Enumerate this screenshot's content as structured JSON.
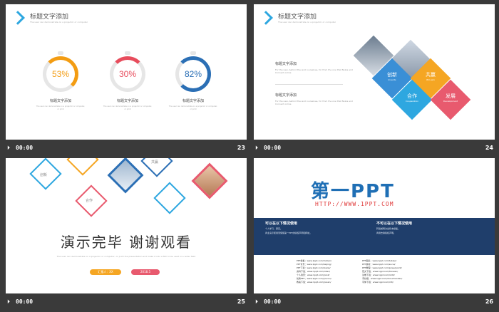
{
  "slides": [
    {
      "number": "23",
      "time": "00:00",
      "title": "标题文字添加",
      "subtitle": "The user can demonstrate on a projector or computer",
      "rings": [
        {
          "value": "53%",
          "color": "#f39c12",
          "caption": "标题文字添加",
          "desc": "The user can demonstrate on a projector or computer, or print"
        },
        {
          "value": "30%",
          "color": "#e74c5c",
          "caption": "标题文字添加",
          "desc": "The user can demonstrate on a projector or computer, or print"
        },
        {
          "value": "82%",
          "color": "#2b6fb5",
          "caption": "标题文字添加",
          "desc": "The user can demonstrate on a projector or computer, or print"
        }
      ]
    },
    {
      "number": "24",
      "time": "00:00",
      "title": "标题文字添加",
      "subtitle": "The user can demonstrate on a projector or computer",
      "blocks": [
        {
          "heading": "标题文字添加",
          "text": "For the new, behind the work ourselves, for from the one that Nokia and Connect online"
        },
        {
          "heading": "标题文字添加",
          "text": "For the new, behind the work ourselves, for from the one that Nokia and Connect online"
        }
      ],
      "diamonds": [
        {
          "label": "创新",
          "sub": "Invents",
          "color": "#3a8fd6"
        },
        {
          "label": "共赢",
          "sub": "Win-win",
          "color": "#f5a623"
        },
        {
          "label": "合作",
          "sub": "Cooperation",
          "color": "#2ea7e0"
        },
        {
          "label": "发展",
          "sub": "Development",
          "color": "#e85a6e"
        }
      ]
    },
    {
      "number": "25",
      "time": "00:00",
      "main_text": "演示完毕  谢谢观看",
      "sub_text": "The user can demonstrate on a projector or computer, or print the presentation and make it into a film to be used in a wider field",
      "small_labels": [
        "创新",
        "共赢",
        "合作"
      ],
      "buttons": [
        "汇报人：XX",
        "2018.5"
      ]
    },
    {
      "number": "26",
      "time": "00:00",
      "logo": "第一PPT",
      "url": "HTTP://WWW.1PPT.COM",
      "can_title": "可以在以下情况使用",
      "can_items": [
        "个人学习、研究。",
        "商业演示使用须保留第一PPT的版权声明和网址。"
      ],
      "cannot_title": "不可以在以下情况使用",
      "cannot_items": [
        "转载或再次出售本模板。",
        "商用去除版权声明。"
      ],
      "links_left": [
        "PPT模板：www.1ppt.com/moban/",
        "PPT背景：www.1ppt.com/beijing/",
        "PPT下载：www.1ppt.com/xiazai/",
        "资料下载：www.1ppt.com/ziliao/",
        "个人简历：www.1ppt.com/jianli/",
        "优秀PPT：www.1ppt.com/youxiu/",
        "教案下载：www.1ppt.com/jiaoan/"
      ],
      "links_right": [
        "PPT图表：www.1ppt.com/tubiao/",
        "PPT素材：www.1ppt.com/sucai/",
        "PPT教程：www.1ppt.com/powerpoint/",
        "范文下载：www.1ppt.com/fanwen/",
        "试卷下载：www.1ppt.com/shiti/",
        "手抄报：www.1ppt.com/shouchaobao/",
        "字体下载：www.1ppt.com/ziti/"
      ]
    }
  ]
}
